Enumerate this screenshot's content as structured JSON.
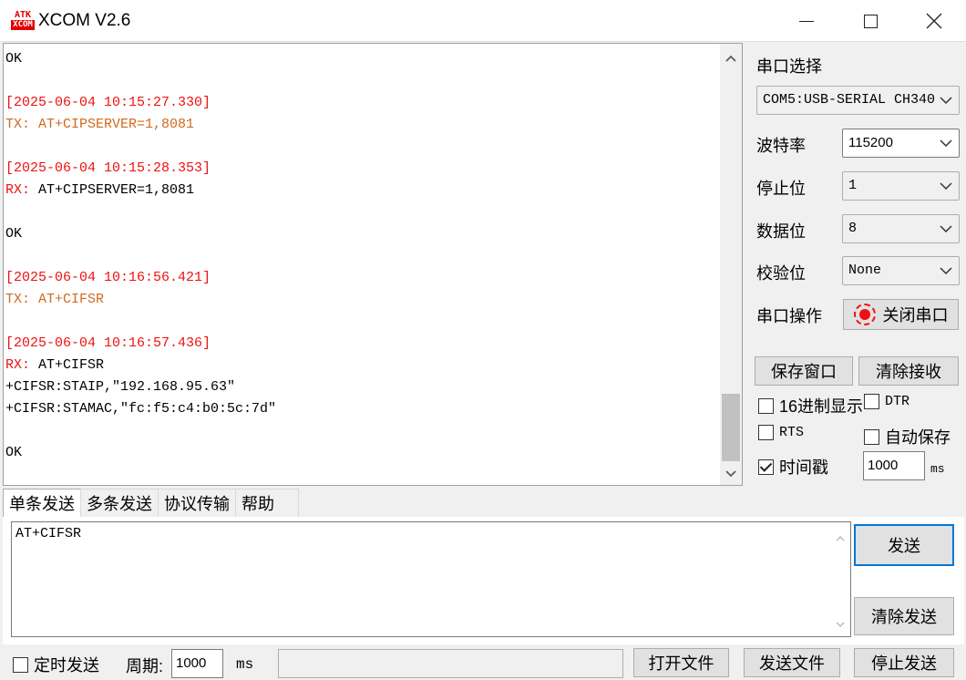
{
  "window": {
    "title": "XCOM V2.6",
    "icon_top": "ATK",
    "icon_bottom": "XCOM",
    "minimize_icon": "minimize-icon",
    "maximize_icon": "maximize-icon",
    "close_icon": "close-icon"
  },
  "receive": {
    "lines": [
      {
        "text": "OK",
        "kind": "plain"
      },
      {
        "text": "",
        "kind": "plain"
      },
      {
        "text": "[2025-06-04 10:15:27.330]",
        "kind": "ts"
      },
      {
        "text": "TX: AT+CIPSERVER=1,8081",
        "kind": "tx"
      },
      {
        "text": "",
        "kind": "plain"
      },
      {
        "text": "[2025-06-04 10:15:28.353]",
        "kind": "ts"
      },
      {
        "tag": "RX: ",
        "text": "AT+CIPSERVER=1,8081",
        "kind": "rx"
      },
      {
        "text": "",
        "kind": "plain"
      },
      {
        "text": "OK",
        "kind": "plain"
      },
      {
        "text": "",
        "kind": "plain"
      },
      {
        "text": "[2025-06-04 10:16:56.421]",
        "kind": "ts"
      },
      {
        "text": "TX: AT+CIFSR",
        "kind": "tx"
      },
      {
        "text": "",
        "kind": "plain"
      },
      {
        "text": "[2025-06-04 10:16:57.436]",
        "kind": "ts"
      },
      {
        "tag": "RX: ",
        "text": "AT+CIFSR",
        "kind": "rx"
      },
      {
        "text": "+CIFSR:STAIP,\"192.168.95.63\"",
        "kind": "plain"
      },
      {
        "text": "+CIFSR:STAMAC,\"fc:f5:c4:b0:5c:7d\"",
        "kind": "plain"
      },
      {
        "text": "",
        "kind": "plain"
      },
      {
        "text": "OK",
        "kind": "plain"
      }
    ]
  },
  "settings": {
    "port_select_label": "串口选择",
    "port_value": "COM5:USB-SERIAL CH340",
    "baud_label": "波特率",
    "baud_value": "115200",
    "stopbits_label": "停止位",
    "stopbits_value": "1",
    "databits_label": "数据位",
    "databits_value": "8",
    "parity_label": "校验位",
    "parity_value": "None",
    "port_op_label": "串口操作",
    "close_port_label": "关闭串口",
    "save_window_label": "保存窗口",
    "clear_receive_label": "清除接收",
    "hex_display_label": "16进制显示",
    "dtr_label": "DTR",
    "rts_label": "RTS",
    "autosave_label": "自动保存",
    "timestamp_label": "时间戳",
    "timestamp_value": "1000",
    "timestamp_unit": "ms",
    "checkbox_state": {
      "hex_display": false,
      "dtr": false,
      "rts": false,
      "autosave": false,
      "timestamp": true
    },
    "led_color": "#ee1111"
  },
  "tabs": [
    "单条发送",
    "多条发送",
    "协议传输",
    "帮助"
  ],
  "send": {
    "text": "AT+CIFSR",
    "send_label": "发送",
    "clear_send_label": "清除发送"
  },
  "bottom": {
    "timed_send_label": "定时发送",
    "period_label": "周期:",
    "period_value": "1000",
    "period_unit": "ms",
    "open_file_label": "打开文件",
    "send_file_label": "发送文件",
    "stop_send_label": "停止发送",
    "timed_send_checked": false
  },
  "colors": {
    "timestamp": "#ee1111",
    "tx": "#d2691e",
    "accent": "#0078d7"
  }
}
